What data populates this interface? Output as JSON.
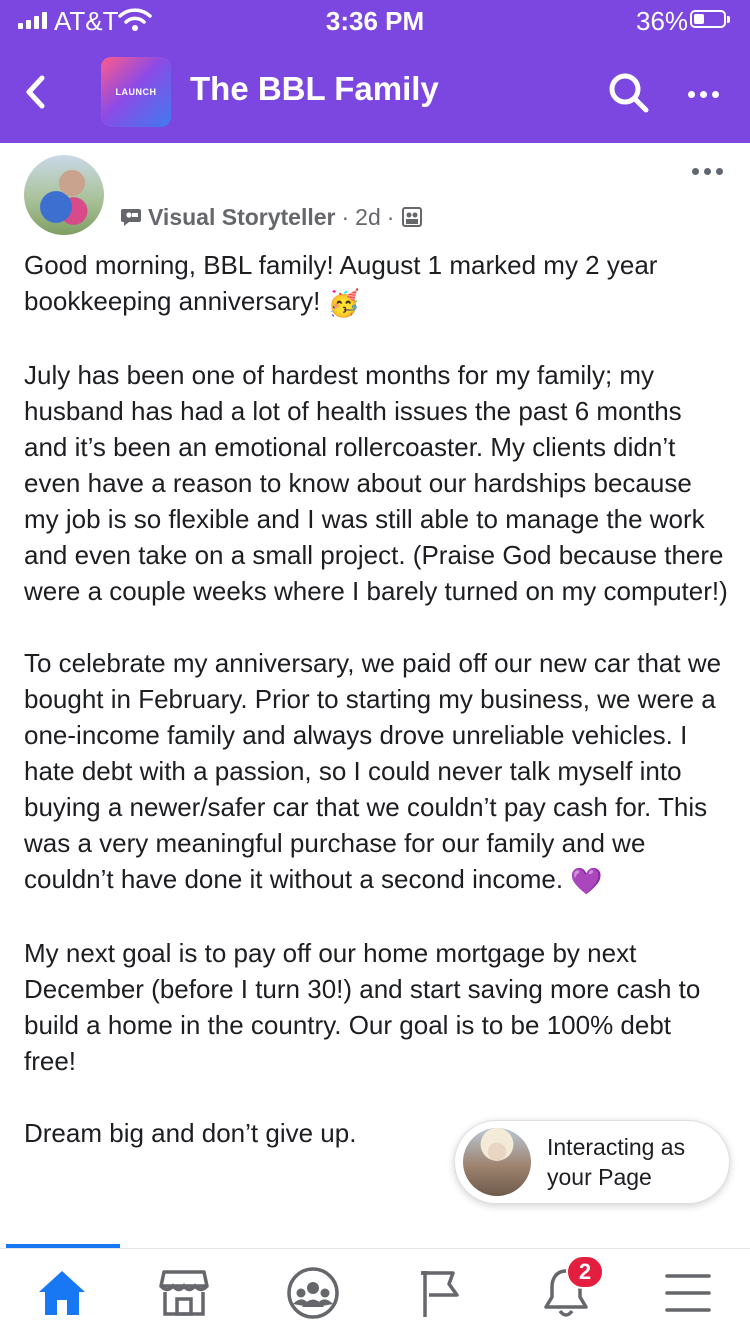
{
  "status_bar": {
    "carrier": "AT&T",
    "time": "3:36 PM",
    "battery_percent": "36%",
    "battery_level": 0.36
  },
  "nav": {
    "logo_text": "LAUNCH",
    "title": "The BBL Family",
    "back_icon": "chevron-left-icon",
    "search_icon": "search-icon",
    "more_icon": "more-horizontal-icon"
  },
  "post": {
    "author_role": "Visual Storyteller",
    "time_ago": "2d",
    "paragraphs": [
      "Good morning, BBL family! August 1 marked my 2 year bookkeeping anniversary!",
      "July has been one of hardest months for my family; my husband has had a lot of health issues the past 6 months and it’s been an emotional rollercoaster. My clients didn’t even have a reason to know about our hardships because my job is so flexible and I was still able to manage the work and even take on a small project. (Praise God because there were a couple weeks where I barely turned on my computer!)",
      "To celebrate my anniversary, we paid off our new car that we bought in February. Prior to starting my business, we were a one-income family and always drove unreliable vehicles. I hate debt with a passion, so I could never talk myself into buying a newer/safer car that we couldn’t pay cash for. This was a very meaningful purchase for our family and we couldn’t have done it without a second income.",
      "My next goal is to pay off our home mortgage by next December (before I turn 30!) and start saving more cash to build a home in the country. Our goal is to be 100% debt free!",
      "Dream big and don’t give up."
    ],
    "emoji_1": "🥳",
    "emoji_2": "💜"
  },
  "interacting_pill": {
    "label": "Interacting as\nyour Page"
  },
  "tabbar": {
    "items": [
      {
        "name": "home",
        "icon": "home-icon",
        "active": true
      },
      {
        "name": "marketplace",
        "icon": "marketplace-icon"
      },
      {
        "name": "groups",
        "icon": "groups-icon"
      },
      {
        "name": "pages",
        "icon": "flag-icon"
      },
      {
        "name": "notifications",
        "icon": "bell-icon",
        "badge": "2"
      },
      {
        "name": "menu",
        "icon": "menu-icon"
      }
    ]
  },
  "colors": {
    "header": "#7b47e0",
    "active_tab": "#1877f2",
    "badge": "#e41e3f"
  }
}
